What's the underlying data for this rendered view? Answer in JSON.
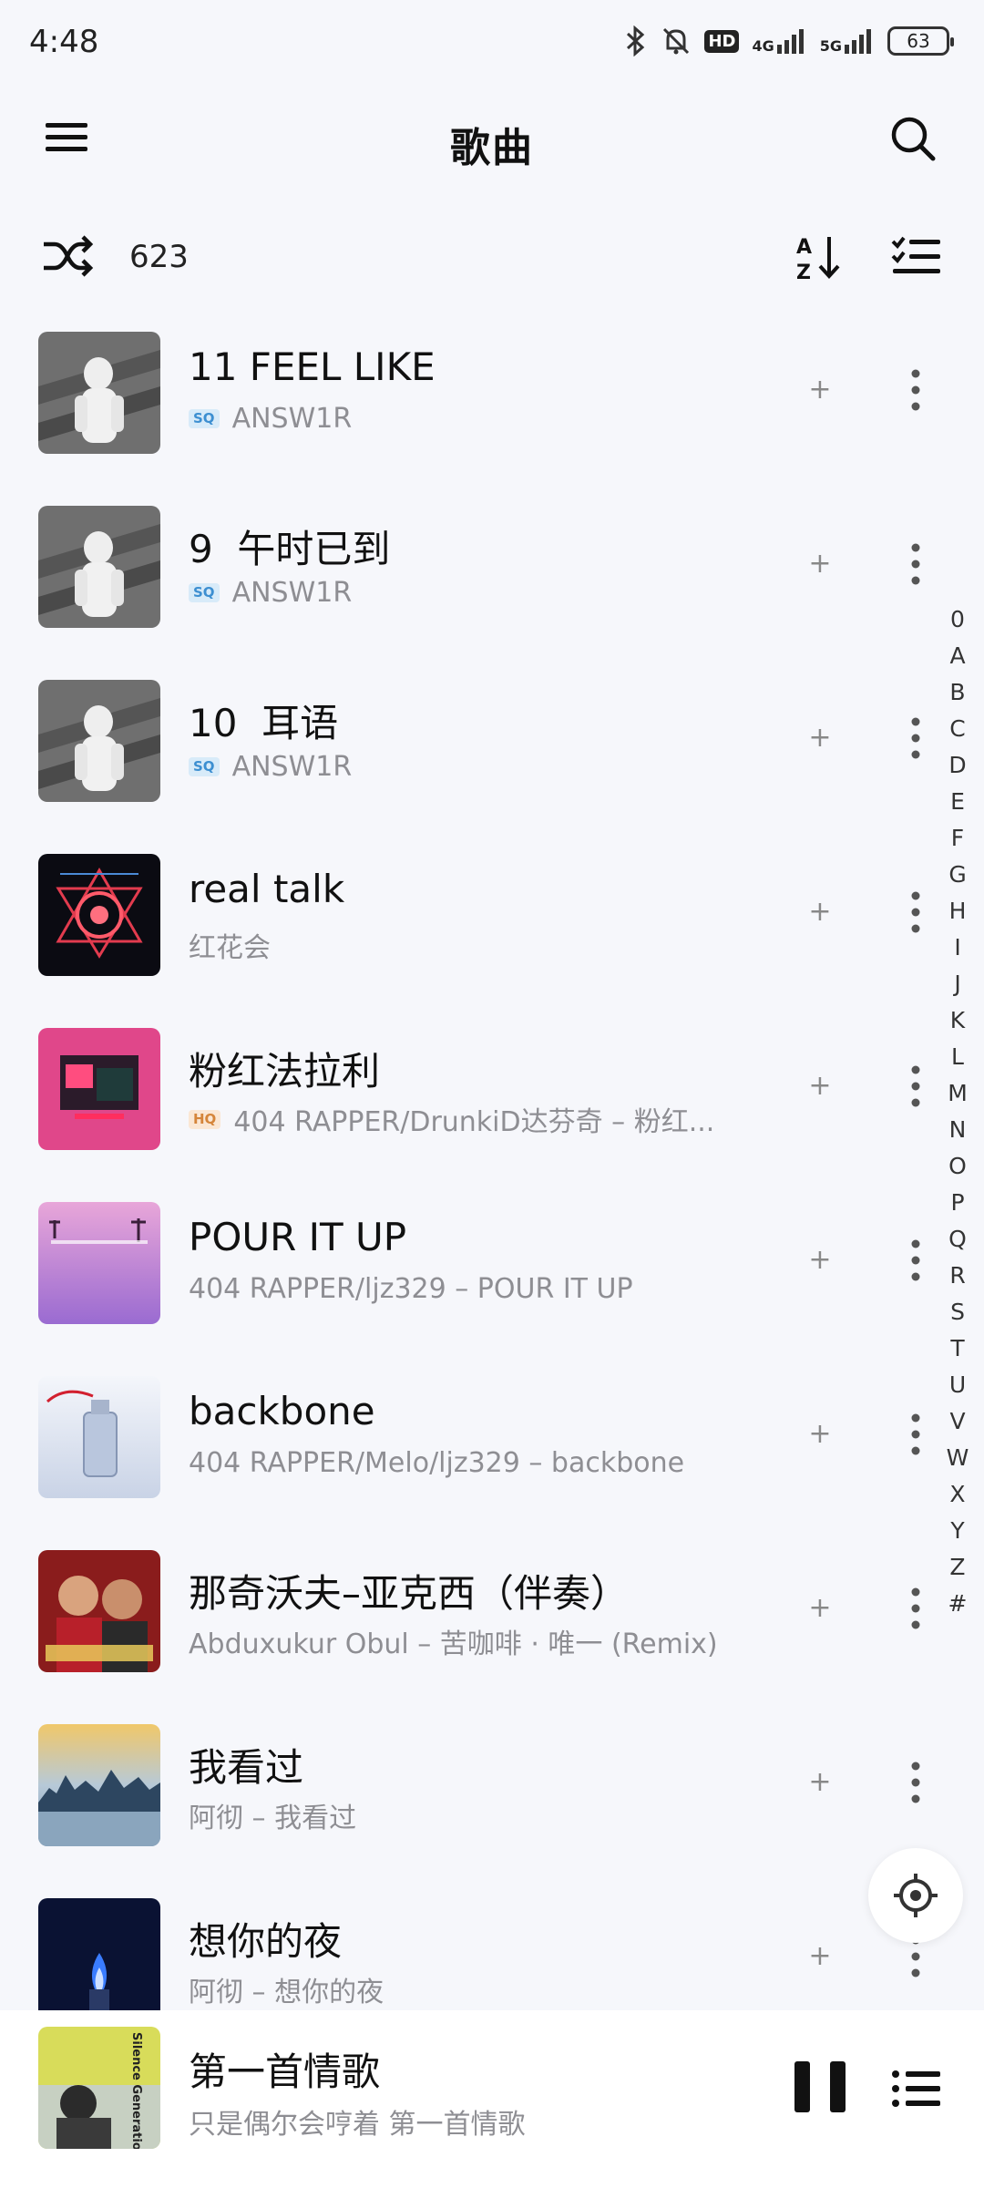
{
  "status_bar": {
    "time": "4:48",
    "hd_label": "HD",
    "net1": "4G",
    "net2": "5G",
    "battery": "63"
  },
  "header": {
    "title": "歌曲"
  },
  "toolbar": {
    "count": "623"
  },
  "songs": [
    {
      "title": "11 FEEL LIKE",
      "quality": "SQ",
      "meta": "ANSW1R",
      "cover": "hoodie-photo"
    },
    {
      "title": "9  午时已到",
      "quality": "SQ",
      "meta": "ANSW1R",
      "cover": "hoodie-photo"
    },
    {
      "title": "10  耳语",
      "quality": "SQ",
      "meta": "ANSW1R",
      "cover": "hoodie-photo"
    },
    {
      "title": "real talk",
      "quality": "",
      "meta": "红花会",
      "cover": "neon-flower"
    },
    {
      "title": "粉红法拉利",
      "quality": "HQ",
      "meta": "404 RAPPER/DrunkiD达芬奇 – 粉红...",
      "cover": "pink-car"
    },
    {
      "title": "POUR IT UP",
      "quality": "",
      "meta": "404 RAPPER/ljz329 – POUR IT UP",
      "cover": "purple-palms"
    },
    {
      "title": "backbone",
      "quality": "",
      "meta": "404 RAPPER/Melo/ljz329 – backbone",
      "cover": "crystal-bottle"
    },
    {
      "title": "那奇沃夫–亚克西（伴奏）",
      "quality": "",
      "meta": "Abduxukur Obul – 苦咖啡 · 唯一 (Remix)",
      "cover": "couple-red"
    },
    {
      "title": "我看过",
      "quality": "",
      "meta": "阿彻 – 我看过",
      "cover": "city-sunset"
    },
    {
      "title": "想你的夜",
      "quality": "",
      "meta": "阿彻 – 想你的夜",
      "cover": "blue-flame"
    }
  ],
  "alphabet": [
    "0",
    "A",
    "B",
    "C",
    "D",
    "E",
    "F",
    "G",
    "H",
    "I",
    "J",
    "K",
    "L",
    "M",
    "N",
    "O",
    "P",
    "Q",
    "R",
    "S",
    "T",
    "U",
    "V",
    "W",
    "X",
    "Y",
    "Z",
    "#"
  ],
  "now_playing": {
    "title": "第一首情歌",
    "subtitle": "只是偶尔会哼着 第一首情歌",
    "cover_text": "Silence Generation"
  },
  "colors": {
    "background": "#f6f7fb",
    "secondary_text": "#8e8e93",
    "sq_badge": "#3d8fd1",
    "hq_badge": "#d5853a"
  },
  "icons": [
    "menu-icon",
    "search-icon",
    "shuffle-icon",
    "sort-az-icon",
    "multi-select-icon",
    "add-icon",
    "more-vertical-icon",
    "locate-icon",
    "pause-icon",
    "playlist-icon"
  ]
}
